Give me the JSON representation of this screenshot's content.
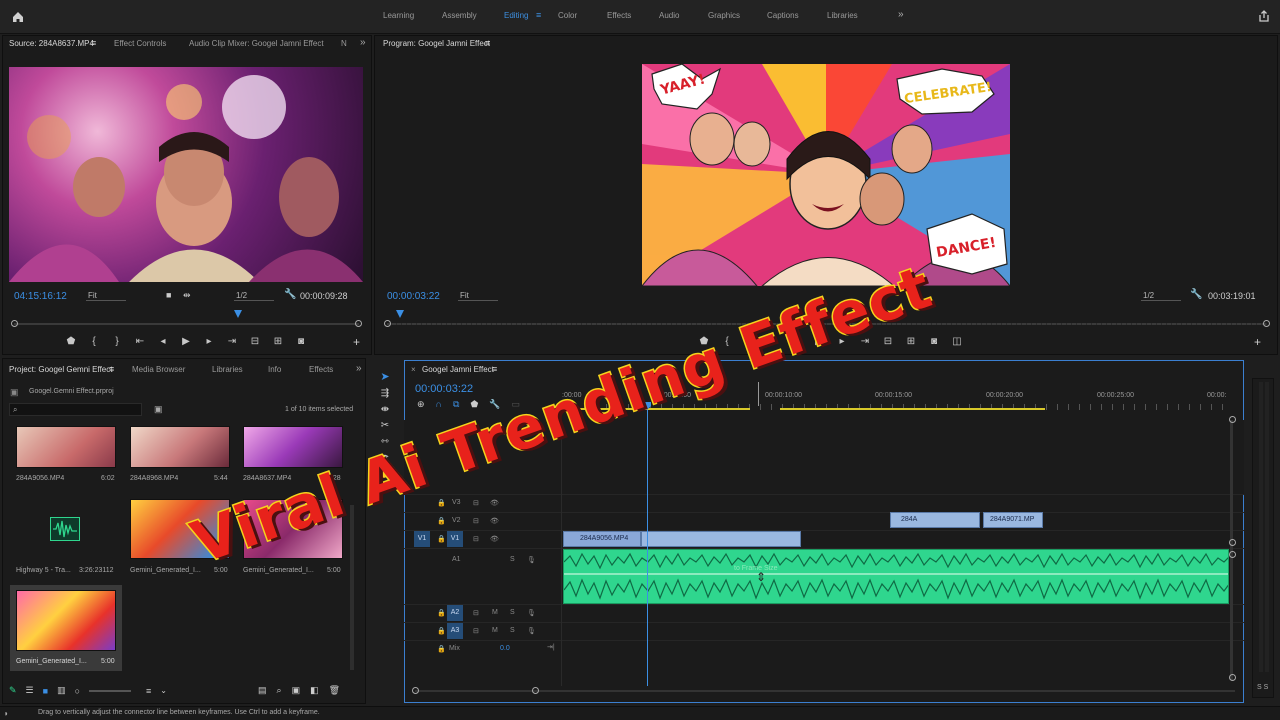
{
  "workspaces": [
    "Learning",
    "Assembly",
    "Editing",
    "Color",
    "Effects",
    "Audio",
    "Graphics",
    "Captions",
    "Libraries"
  ],
  "source_panel": {
    "tabs": [
      "Source: 284A8637.MP4",
      "Effect Controls",
      "Audio Clip Mixer: Googel Jamni Effect",
      "N"
    ],
    "timecode": "04:15:16:12",
    "fit": "Fit",
    "res": "1/2",
    "duration": "00:00:09:28"
  },
  "program_panel": {
    "title": "Program: Googel Jamni Effect",
    "timecode": "00:00:03:22",
    "fit": "Fit",
    "res": "1/2",
    "duration": "00:03:19:01"
  },
  "project_panel": {
    "tabs": [
      "Project: Googel Gemni Effect",
      "Media Browser",
      "Libraries",
      "Info",
      "Effects"
    ],
    "file": "Googel.Gemni Effect.prproj",
    "items_selected": "1 of 10 items selected",
    "items": [
      {
        "name": "284A9056.MP4",
        "dur": "6:02"
      },
      {
        "name": "284A8968.MP4",
        "dur": "5:44"
      },
      {
        "name": "284A8637.MP4",
        "dur": "9:28"
      },
      {
        "name": "Highway 5 - Tra...",
        "dur": "3:26:23112"
      },
      {
        "name": "Gemini_Generated_I...",
        "dur": "5:00"
      },
      {
        "name": "Gemini_Generated_I...",
        "dur": "5:00"
      },
      {
        "name": "Gemini_Generated_I...",
        "dur": "5:00"
      }
    ]
  },
  "timeline": {
    "tab": "Googel Jamni Effect",
    "timecode": "00:00:03:22",
    "ruler": [
      ":00:00",
      "00:00:05:00",
      "00:00:10:00",
      "00:00:15:00",
      "00:00:20:00",
      "00:00:25:00",
      "00:00:"
    ],
    "tracks": [
      "V3",
      "V2",
      "V1",
      "A1",
      "A2",
      "A3"
    ],
    "mix_label": "Mix",
    "mix_value": "0.0",
    "clips": {
      "c1": "284A9056.MP4",
      "c2": "284A",
      "c3": "284A9071.MP"
    },
    "tooltip": "to Frame Size"
  },
  "overlay_text": "Viral Ai Trending Effect",
  "status_bar": "Drag to vertically adjust the connector line between keyframes. Use Ctrl to add a keyframe.",
  "comic_words": {
    "yaay": "YAAY!",
    "celebrate": "CELEBRATE!",
    "dance": "DANCE!"
  },
  "colors": {
    "accent": "#3b8fe4",
    "audio_clip": "#2fd68e",
    "overlay_red": "#e8221b",
    "overlay_yellow": "#f5d31c"
  }
}
